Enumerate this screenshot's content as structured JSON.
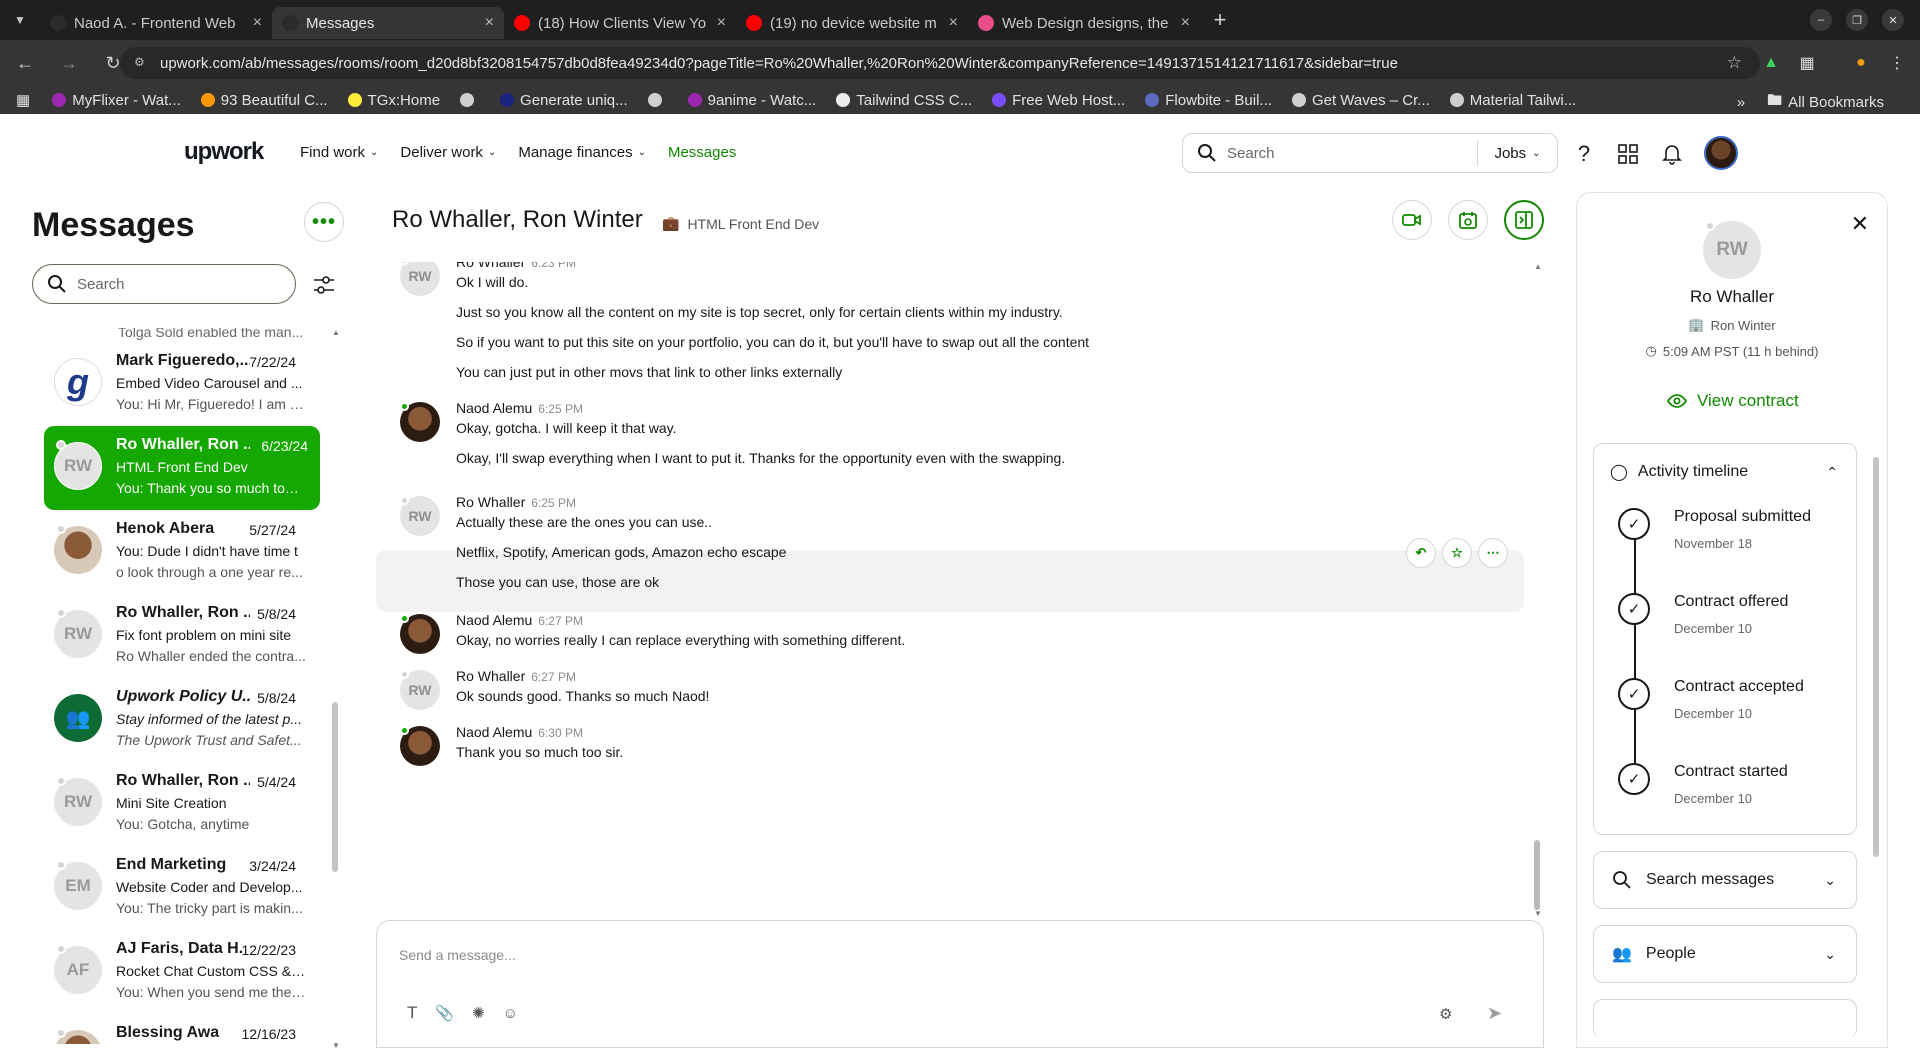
{
  "browser": {
    "tabs": [
      {
        "title": "Naod A. - Frontend Web",
        "favicon": "upwork-favicon",
        "color": "#2b2b2b"
      },
      {
        "title": "Messages",
        "favicon": "upwork-favicon",
        "color": "#2b2b2b",
        "active": true
      },
      {
        "title": "(18) How Clients View Yo",
        "favicon": "youtube-favicon",
        "color": "#ff0000"
      },
      {
        "title": "(19) no device website m",
        "favicon": "youtube-favicon",
        "color": "#ff0000"
      },
      {
        "title": "Web Design designs, the",
        "favicon": "dribbble-favicon",
        "color": "#ea4c89"
      }
    ],
    "url": "upwork.com/ab/messages/rooms/room_d20d8bf3208154757db0d8fea49234d0?pageTitle=Ro%20Whaller,%20Ron%20Winter&companyReference=1491371514121711617&sidebar=true",
    "bookmarks": [
      {
        "label": "MyFlixer - Wat...",
        "color": "#9c27b0"
      },
      {
        "label": "93 Beautiful C...",
        "color": "#ff9800"
      },
      {
        "label": "TGx:Home",
        "color": "#ffeb3b"
      },
      {
        "label": "",
        "color": "#cfcfcf"
      },
      {
        "label": "Generate uniq...",
        "color": "#1a237e"
      },
      {
        "label": "",
        "color": "#cfcfcf"
      },
      {
        "label": "9anime - Watc...",
        "color": "#9c27b0"
      },
      {
        "label": "Tailwind CSS C...",
        "color": "#eeeeee"
      },
      {
        "label": "Free Web Host...",
        "color": "#7c4dff"
      },
      {
        "label": "Flowbite - Buil...",
        "color": "#5c6bc0"
      },
      {
        "label": "Get Waves – Cr...",
        "color": "#cfcfcf"
      },
      {
        "label": "Material Tailwi...",
        "color": "#cfcfcf"
      }
    ],
    "all_bookmarks": "All Bookmarks"
  },
  "header": {
    "logo": "upwork",
    "nav": [
      {
        "label": "Find work"
      },
      {
        "label": "Deliver work"
      },
      {
        "label": "Manage finances"
      },
      {
        "label": "Messages"
      }
    ],
    "search_placeholder": "Search",
    "search_scope": "Jobs"
  },
  "left": {
    "title": "Messages",
    "search_placeholder": "Search",
    "cut_line": "Tolga Sold enabled the man...",
    "rooms": [
      {
        "name": "Mark Figueredo,...",
        "date": "7/22/24",
        "l2": "Embed Video Carousel and ...",
        "l3": "You: Hi Mr, Figueredo! I am a...",
        "avatar": "g",
        "avatar_bg": "#1e3a8a"
      },
      {
        "name": "Ro Whaller, Ron ...",
        "date": "6/23/24",
        "l2": "HTML Front End Dev",
        "l3": "You: Thank you so much too ...",
        "avatar": "RW",
        "active": true
      },
      {
        "name": "Henok Abera",
        "date": "5/27/24",
        "l2": "You: Dude I didn't have time t",
        "l3": "o look through a one year re...",
        "avatar": "",
        "photo": true
      },
      {
        "name": "Ro Whaller, Ron ...",
        "date": "5/8/24",
        "l2": "Fix font problem on mini site",
        "l3": "Ro Whaller ended the contra...",
        "avatar": "RW"
      },
      {
        "name": "Upwork Policy U...",
        "date": "5/8/24",
        "l2": "Stay informed of the latest p...",
        "l3": "The Upwork Trust and Safet...",
        "avatar": "people",
        "avatar_bg": "#0d6b35",
        "italic": true
      },
      {
        "name": "Ro Whaller, Ron ...",
        "date": "5/4/24",
        "l2": "Mini Site Creation",
        "l3": "You: Gotcha, anytime",
        "avatar": "RW"
      },
      {
        "name": "End Marketing",
        "date": "3/24/24",
        "l2": "Website Coder and Develop...",
        "l3": "You: The tricky part is makin...",
        "avatar": "EM"
      },
      {
        "name": "AJ Faris, Data H.",
        "date": "12/22/23",
        "l2": "Rocket Chat Custom CSS & ...",
        "l3": "You: When you send me the ...",
        "avatar": "AF"
      },
      {
        "name": "Blessing Awa",
        "date": "12/16/23",
        "l2": "",
        "l3": "",
        "avatar": "",
        "photo": true
      }
    ]
  },
  "chat": {
    "title": "Ro Whaller, Ron Winter",
    "subtitle": "HTML Front End Dev",
    "messages": [
      {
        "author": "Ro Whaller",
        "time": "6:23 PM",
        "avatar": "RW",
        "lines": [
          "Ok I will do.",
          "Just so you know all the content on my site is top secret, only for certain clients within my industry.",
          "So if you want to put this site on your portfolio, you can do it, but you'll have to swap out all the content",
          "You can just put in other movs that link to other links externally"
        ]
      },
      {
        "author": "Naod Alemu",
        "time": "6:25 PM",
        "avatar": "",
        "lines": [
          "Okay, gotcha. I will keep it that way.",
          "Okay, I'll swap everything when I want to put it. Thanks for the opportunity even with the swapping."
        ]
      },
      {
        "author": "Ro Whaller",
        "time": "6:25 PM",
        "avatar": "RW",
        "lines": [
          "Actually these are the ones you can use..",
          "Netflix, Spotify, American gods, Amazon echo escape",
          "Those you can use, those are ok"
        ]
      },
      {
        "author": "Naod Alemu",
        "time": "6:27 PM",
        "avatar": "",
        "lines": [
          "Okay, no worries really I can replace everything with something different."
        ]
      },
      {
        "author": "Ro Whaller",
        "time": "6:27 PM",
        "avatar": "RW",
        "lines": [
          "Ok sounds good. Thanks so much Naod!"
        ]
      },
      {
        "author": "Naod Alemu",
        "time": "6:30 PM",
        "avatar": "",
        "lines": [
          "Thank you so much too sir."
        ]
      }
    ],
    "composer_placeholder": "Send a message..."
  },
  "sidebar": {
    "initials": "RW",
    "name": "Ro Whaller",
    "company": "Ron Winter",
    "local_time": "5:09 AM PST (11 h behind)",
    "view_contract": "View contract",
    "timeline_title": "Activity timeline",
    "timeline": [
      {
        "title": "Proposal submitted",
        "date": "November 18"
      },
      {
        "title": "Contract offered",
        "date": "December 10"
      },
      {
        "title": "Contract accepted",
        "date": "December 10"
      },
      {
        "title": "Contract started",
        "date": "December 10"
      }
    ],
    "search_messages": "Search messages",
    "people": "People"
  },
  "colors": {
    "accent": "#108a00",
    "active_room": "#14a800"
  }
}
